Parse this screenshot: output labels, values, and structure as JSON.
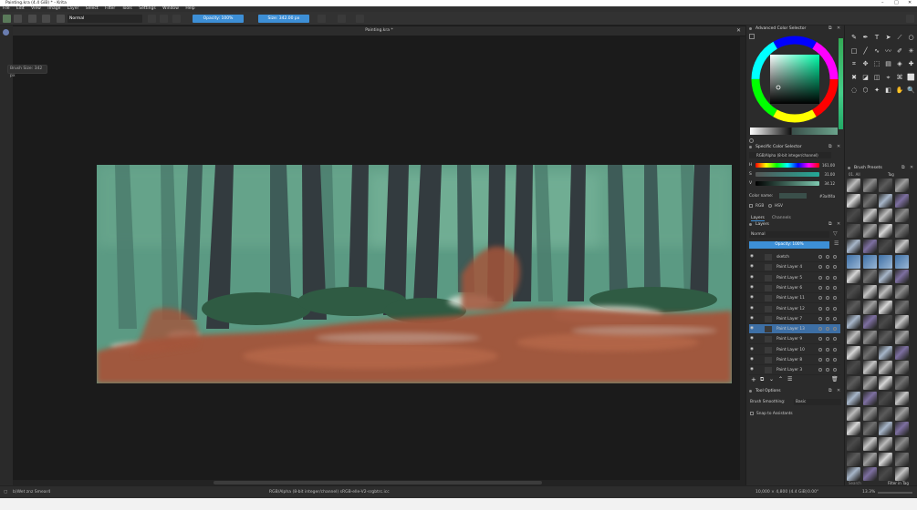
{
  "window": {
    "title": "Painting.kra (4.4 GiB)  * - Krita",
    "document_tab": "Painting.kra *",
    "brush_tooltip": "Brush Size: 342 px"
  },
  "menu": [
    "File",
    "Edit",
    "View",
    "Image",
    "Layer",
    "Select",
    "Filter",
    "Tools",
    "Settings",
    "Window",
    "Help"
  ],
  "toolbar": {
    "blend_mode": "Normal",
    "opacity": "Opacity: 100%",
    "size": "Size: 342.00 px",
    "accent": "#3d8fd6"
  },
  "advanced_color_selector": {
    "title": "Advanced Color Selector"
  },
  "specific_color_selector": {
    "title": "Specific Color Selector",
    "model": "RGB/Alpha (8-bit integer/channel)",
    "h_label": "H",
    "h_value": "161.00",
    "s_label": "S",
    "s_value": "31.00",
    "v_label": "V",
    "v_value": "34.12",
    "color_name_label": "Color name:",
    "color_name_value": "#3a4f4a",
    "rgb_label": "RGB",
    "hsv_label": "HSV"
  },
  "layers_panel": {
    "tabs": [
      "Layers",
      "Channels"
    ],
    "blend_mode": "Normal",
    "opacity": "Opacity: 100%",
    "layers": [
      {
        "name": "sketch",
        "selected": false
      },
      {
        "name": "Paint Layer 4",
        "selected": false
      },
      {
        "name": "Paint Layer 5",
        "selected": false
      },
      {
        "name": "Paint Layer 6",
        "selected": false
      },
      {
        "name": "Paint Layer 11",
        "selected": false
      },
      {
        "name": "Paint Layer 12",
        "selected": false
      },
      {
        "name": "Paint Layer 7",
        "selected": false
      },
      {
        "name": "Paint Layer 13",
        "selected": true
      },
      {
        "name": "Paint Layer 9",
        "selected": false
      },
      {
        "name": "Paint Layer 10",
        "selected": false
      },
      {
        "name": "Paint Layer 8",
        "selected": false
      },
      {
        "name": "Paint Layer 3",
        "selected": false
      }
    ]
  },
  "tool_options": {
    "title": "Tool Options",
    "smoothing_label": "Brush Smoothing:",
    "smoothing_value": "Basic",
    "snap_label": "Snap to Assistants"
  },
  "brush_presets": {
    "title": "Brush Presets",
    "tag_label": "Tag",
    "filter_label": "Filter in Tag",
    "search_placeholder": "Search"
  },
  "status": {
    "left": "b)Wet znz Smear4",
    "center": "RGB/Alpha (8-bit integer/channel)  sRGB-elle-V2-srgbtrc.icc",
    "right_size": "10,000 × 4,800 (4.4 GiB)",
    "rotation": "0.00°",
    "zoom": "13.3%"
  },
  "scene": {
    "sky": "#5a9a84",
    "ground": "#a4553a"
  }
}
